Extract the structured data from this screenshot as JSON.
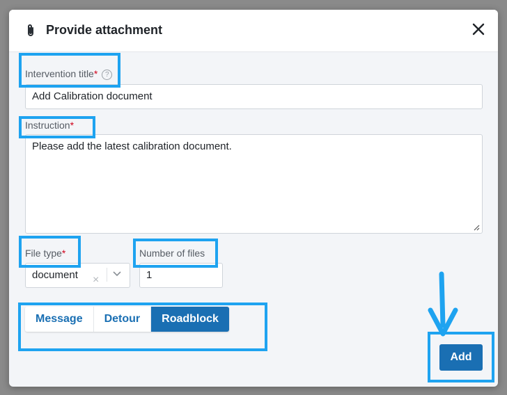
{
  "modal": {
    "title": "Provide attachment"
  },
  "form": {
    "intervention_title": {
      "label": "Intervention title",
      "required": "*",
      "help": "?",
      "value": "Add Calibration document"
    },
    "instruction": {
      "label": "Instruction",
      "required": "*",
      "value": "Please add the latest calibration document."
    },
    "file_type": {
      "label": "File type",
      "required": "*",
      "value": "document",
      "clear": "×"
    },
    "number_of_files": {
      "label": "Number of files",
      "value": "1"
    }
  },
  "segments": [
    {
      "label": "Message",
      "active": false
    },
    {
      "label": "Detour",
      "active": false
    },
    {
      "label": "Roadblock",
      "active": true
    }
  ],
  "footer": {
    "add_label": "Add"
  },
  "colors": {
    "primary": "#1a6fb3",
    "highlight": "#1ea3f0",
    "required": "#d0021b"
  }
}
